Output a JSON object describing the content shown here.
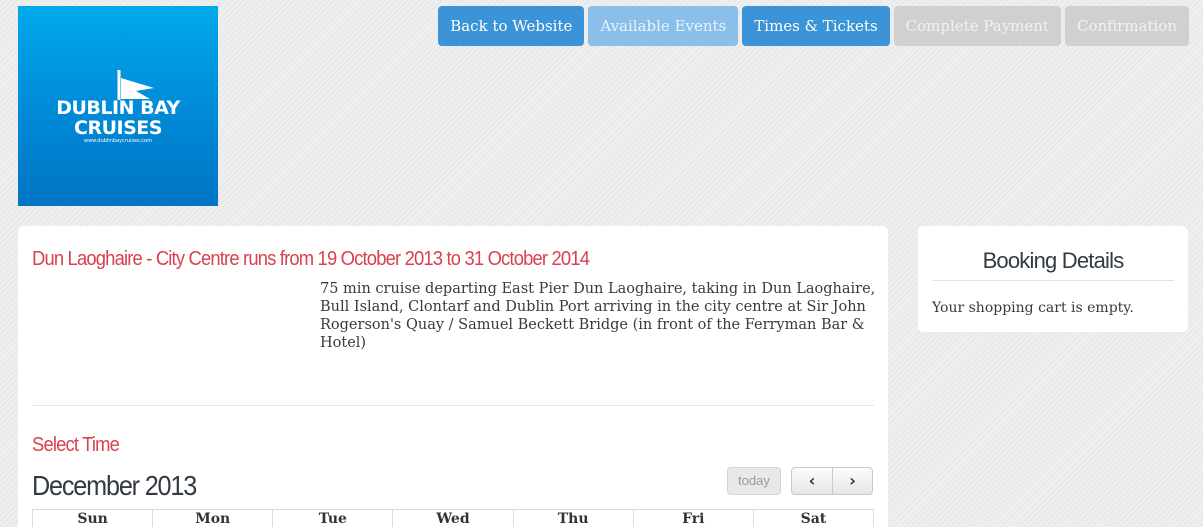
{
  "logo": {
    "line1": "DUBLIN BAY",
    "line2": "CRUISES",
    "url": "www.dublinbaycruises.com",
    "icon": "flag-icon",
    "gradient_top": "#00a9ec",
    "gradient_bottom": "#0075c4"
  },
  "nav": {
    "back": "Back to Website",
    "events": "Available Events",
    "times": "Times & Tickets",
    "payment": "Complete Payment",
    "confirmation": "Confirmation"
  },
  "event": {
    "title": "Dun Laoghaire - City Centre runs from 19 October 2013 to 31 October 2014",
    "description": "75 min cruise departing East Pier Dun Laoghaire, taking in Dun Laoghaire, Bull Island, Clontarf and Dublin Port arriving in the city centre at Sir John Rogerson's Quay / Samuel Beckett Bridge (in front of the Ferryman Bar & Hotel)"
  },
  "calendar": {
    "heading": "Select Time",
    "month": "December 2013",
    "today_label": "today",
    "prev_icon": "chevron-left-icon",
    "next_icon": "chevron-right-icon",
    "prev_glyph": "‹",
    "next_glyph": "›",
    "days": [
      "Sun",
      "Mon",
      "Tue",
      "Wed",
      "Thu",
      "Fri",
      "Sat"
    ]
  },
  "booking": {
    "title": "Booking Details",
    "cart": "Your shopping cart is empty."
  },
  "colors": {
    "accent_red": "#d9414f",
    "button_blue": "#3b93d8",
    "button_disabled": "#d0d0d0"
  }
}
